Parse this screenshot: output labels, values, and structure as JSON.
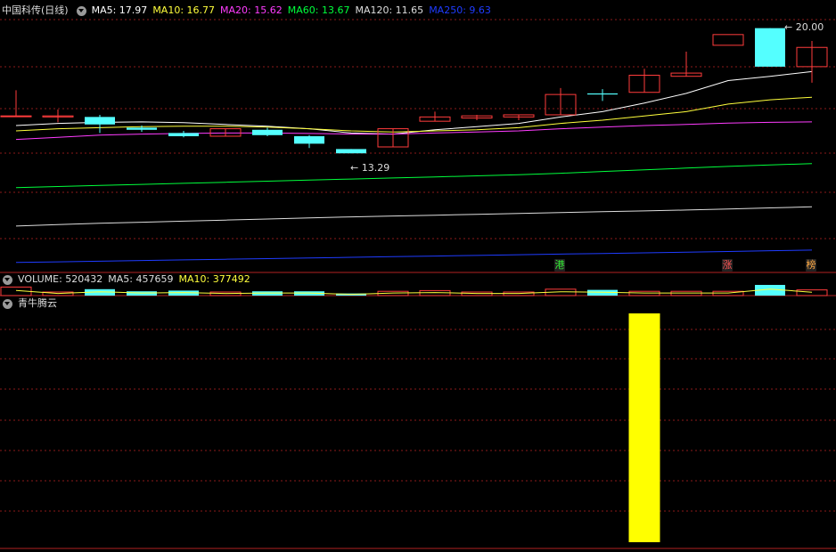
{
  "main_panel": {
    "stock_title": "中国科传(日线)",
    "indicators": [
      {
        "label": "MA5: 17.97",
        "color": "#ffffff"
      },
      {
        "label": "MA10: 16.77",
        "color": "#ffff3c"
      },
      {
        "label": "MA20: 15.62",
        "color": "#ff3cff"
      },
      {
        "label": "MA60: 13.67",
        "color": "#00ff3c"
      },
      {
        "label": "MA120: 11.65",
        "color": "#dddddd"
      },
      {
        "label": "MA250: 9.63",
        "color": "#1f3cff"
      }
    ],
    "high_marker": "20.00",
    "low_marker": "13.29",
    "tags": [
      {
        "text": "港",
        "color": "#33ee33"
      },
      {
        "text": "涨",
        "color": "#ff5555"
      },
      {
        "text": "榜",
        "color": "#ffaa44"
      }
    ]
  },
  "volume_panel": {
    "label": "VOLUME: 520432",
    "ma5": "MA5: 457659",
    "ma10": "MA10: 377492"
  },
  "indicator_panel": {
    "title": "青牛腾云"
  },
  "colors": {
    "up": "#ff3c3c",
    "down": "#54ffff",
    "signal": "#ffff00",
    "grid": "#8b1a1a"
  },
  "chart_data": {
    "type": "candlestick",
    "candles": [
      {
        "o": 15.9,
        "h": 17.1,
        "l": 15.9,
        "c": 15.9
      },
      {
        "o": 15.85,
        "h": 16.2,
        "l": 15.6,
        "c": 15.9
      },
      {
        "o": 15.85,
        "h": 15.95,
        "l": 15.1,
        "c": 15.5
      },
      {
        "o": 15.35,
        "h": 15.45,
        "l": 15.15,
        "c": 15.25
      },
      {
        "o": 15.1,
        "h": 15.2,
        "l": 14.9,
        "c": 14.95
      },
      {
        "o": 14.95,
        "h": 15.3,
        "l": 14.95,
        "c": 15.3
      },
      {
        "o": 15.25,
        "h": 15.35,
        "l": 14.95,
        "c": 15.0
      },
      {
        "o": 14.95,
        "h": 15.0,
        "l": 14.4,
        "c": 14.6
      },
      {
        "o": 14.35,
        "h": 14.35,
        "l": 14.15,
        "c": 14.15
      },
      {
        "o": 14.45,
        "h": 15.3,
        "l": 14.45,
        "c": 15.3
      },
      {
        "o": 15.65,
        "h": 16.1,
        "l": 15.65,
        "c": 15.85
      },
      {
        "o": 15.8,
        "h": 15.95,
        "l": 15.7,
        "c": 15.9
      },
      {
        "o": 15.85,
        "h": 15.95,
        "l": 15.7,
        "c": 15.95
      },
      {
        "o": 15.95,
        "h": 17.2,
        "l": 15.95,
        "c": 16.9
      },
      {
        "o": 16.95,
        "h": 17.15,
        "l": 16.6,
        "c": 16.9
      },
      {
        "o": 17.0,
        "h": 18.1,
        "l": 17.0,
        "c": 17.8
      },
      {
        "o": 17.75,
        "h": 18.9,
        "l": 17.75,
        "c": 17.9
      },
      {
        "o": 19.2,
        "h": 19.2,
        "l": 19.2,
        "c": 19.7
      },
      {
        "o": 20.0,
        "h": 20.0,
        "l": 18.2,
        "c": 18.2
      },
      {
        "o": 18.2,
        "h": 19.4,
        "l": 17.45,
        "c": 19.1
      }
    ],
    "ma_lines": [
      {
        "name": "MA5",
        "color": "#ffffff",
        "values": [
          15.45,
          15.55,
          15.6,
          15.62,
          15.58,
          15.5,
          15.42,
          15.3,
          15.1,
          15.05,
          15.25,
          15.4,
          15.55,
          15.85,
          16.1,
          16.5,
          16.95,
          17.55,
          17.75,
          17.97
        ]
      },
      {
        "name": "MA10",
        "color": "#ffff3c",
        "values": [
          15.2,
          15.3,
          15.35,
          15.4,
          15.42,
          15.42,
          15.38,
          15.3,
          15.2,
          15.15,
          15.2,
          15.25,
          15.35,
          15.55,
          15.7,
          15.9,
          16.1,
          16.45,
          16.65,
          16.77
        ]
      },
      {
        "name": "MA20",
        "color": "#ff3cff",
        "values": [
          14.8,
          14.9,
          15.0,
          15.05,
          15.08,
          15.1,
          15.1,
          15.08,
          15.05,
          15.05,
          15.1,
          15.15,
          15.2,
          15.3,
          15.38,
          15.45,
          15.5,
          15.56,
          15.6,
          15.62
        ]
      },
      {
        "name": "MA60",
        "color": "#00ff3c",
        "values": [
          12.55,
          12.6,
          12.65,
          12.7,
          12.75,
          12.8,
          12.85,
          12.9,
          12.95,
          13.0,
          13.05,
          13.1,
          13.15,
          13.22,
          13.3,
          13.38,
          13.46,
          13.54,
          13.61,
          13.67
        ]
      },
      {
        "name": "MA120",
        "color": "#dddddd",
        "values": [
          10.75,
          10.82,
          10.88,
          10.93,
          10.98,
          11.03,
          11.08,
          11.13,
          11.18,
          11.22,
          11.26,
          11.3,
          11.34,
          11.38,
          11.42,
          11.46,
          11.5,
          11.55,
          11.6,
          11.65
        ]
      },
      {
        "name": "MA250",
        "color": "#1f3cff",
        "values": [
          9.05,
          9.08,
          9.11,
          9.14,
          9.17,
          9.2,
          9.23,
          9.26,
          9.29,
          9.32,
          9.35,
          9.38,
          9.41,
          9.44,
          9.47,
          9.5,
          9.53,
          9.56,
          9.6,
          9.63
        ]
      }
    ],
    "volume": [
      1.2,
      0.5,
      0.9,
      0.6,
      0.7,
      0.5,
      0.6,
      0.6,
      0.3,
      0.6,
      0.7,
      0.5,
      0.5,
      0.9,
      0.8,
      0.6,
      0.6,
      0.6,
      1.5,
      0.8
    ],
    "signal": [
      0,
      0,
      0,
      0,
      0,
      0,
      0,
      0,
      0,
      0,
      0,
      0,
      0,
      0,
      0,
      1,
      0,
      0,
      0,
      0
    ]
  }
}
